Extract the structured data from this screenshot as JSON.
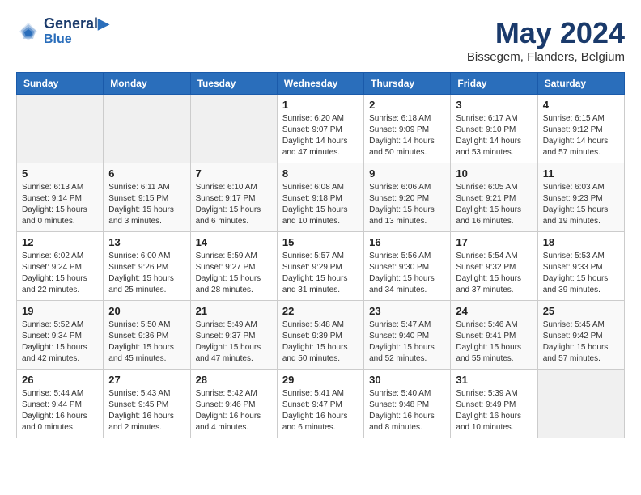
{
  "header": {
    "logo_line1": "General",
    "logo_line2": "Blue",
    "month_year": "May 2024",
    "location": "Bissegem, Flanders, Belgium"
  },
  "weekdays": [
    "Sunday",
    "Monday",
    "Tuesday",
    "Wednesday",
    "Thursday",
    "Friday",
    "Saturday"
  ],
  "weeks": [
    [
      {
        "day": "",
        "empty": true
      },
      {
        "day": "",
        "empty": true
      },
      {
        "day": "",
        "empty": true
      },
      {
        "day": "1",
        "sunrise": "6:20 AM",
        "sunset": "9:07 PM",
        "daylight": "14 hours and 47 minutes."
      },
      {
        "day": "2",
        "sunrise": "6:18 AM",
        "sunset": "9:09 PM",
        "daylight": "14 hours and 50 minutes."
      },
      {
        "day": "3",
        "sunrise": "6:17 AM",
        "sunset": "9:10 PM",
        "daylight": "14 hours and 53 minutes."
      },
      {
        "day": "4",
        "sunrise": "6:15 AM",
        "sunset": "9:12 PM",
        "daylight": "14 hours and 57 minutes."
      }
    ],
    [
      {
        "day": "5",
        "sunrise": "6:13 AM",
        "sunset": "9:14 PM",
        "daylight": "15 hours and 0 minutes."
      },
      {
        "day": "6",
        "sunrise": "6:11 AM",
        "sunset": "9:15 PM",
        "daylight": "15 hours and 3 minutes."
      },
      {
        "day": "7",
        "sunrise": "6:10 AM",
        "sunset": "9:17 PM",
        "daylight": "15 hours and 6 minutes."
      },
      {
        "day": "8",
        "sunrise": "6:08 AM",
        "sunset": "9:18 PM",
        "daylight": "15 hours and 10 minutes."
      },
      {
        "day": "9",
        "sunrise": "6:06 AM",
        "sunset": "9:20 PM",
        "daylight": "15 hours and 13 minutes."
      },
      {
        "day": "10",
        "sunrise": "6:05 AM",
        "sunset": "9:21 PM",
        "daylight": "15 hours and 16 minutes."
      },
      {
        "day": "11",
        "sunrise": "6:03 AM",
        "sunset": "9:23 PM",
        "daylight": "15 hours and 19 minutes."
      }
    ],
    [
      {
        "day": "12",
        "sunrise": "6:02 AM",
        "sunset": "9:24 PM",
        "daylight": "15 hours and 22 minutes."
      },
      {
        "day": "13",
        "sunrise": "6:00 AM",
        "sunset": "9:26 PM",
        "daylight": "15 hours and 25 minutes."
      },
      {
        "day": "14",
        "sunrise": "5:59 AM",
        "sunset": "9:27 PM",
        "daylight": "15 hours and 28 minutes."
      },
      {
        "day": "15",
        "sunrise": "5:57 AM",
        "sunset": "9:29 PM",
        "daylight": "15 hours and 31 minutes."
      },
      {
        "day": "16",
        "sunrise": "5:56 AM",
        "sunset": "9:30 PM",
        "daylight": "15 hours and 34 minutes."
      },
      {
        "day": "17",
        "sunrise": "5:54 AM",
        "sunset": "9:32 PM",
        "daylight": "15 hours and 37 minutes."
      },
      {
        "day": "18",
        "sunrise": "5:53 AM",
        "sunset": "9:33 PM",
        "daylight": "15 hours and 39 minutes."
      }
    ],
    [
      {
        "day": "19",
        "sunrise": "5:52 AM",
        "sunset": "9:34 PM",
        "daylight": "15 hours and 42 minutes."
      },
      {
        "day": "20",
        "sunrise": "5:50 AM",
        "sunset": "9:36 PM",
        "daylight": "15 hours and 45 minutes."
      },
      {
        "day": "21",
        "sunrise": "5:49 AM",
        "sunset": "9:37 PM",
        "daylight": "15 hours and 47 minutes."
      },
      {
        "day": "22",
        "sunrise": "5:48 AM",
        "sunset": "9:39 PM",
        "daylight": "15 hours and 50 minutes."
      },
      {
        "day": "23",
        "sunrise": "5:47 AM",
        "sunset": "9:40 PM",
        "daylight": "15 hours and 52 minutes."
      },
      {
        "day": "24",
        "sunrise": "5:46 AM",
        "sunset": "9:41 PM",
        "daylight": "15 hours and 55 minutes."
      },
      {
        "day": "25",
        "sunrise": "5:45 AM",
        "sunset": "9:42 PM",
        "daylight": "15 hours and 57 minutes."
      }
    ],
    [
      {
        "day": "26",
        "sunrise": "5:44 AM",
        "sunset": "9:44 PM",
        "daylight": "16 hours and 0 minutes."
      },
      {
        "day": "27",
        "sunrise": "5:43 AM",
        "sunset": "9:45 PM",
        "daylight": "16 hours and 2 minutes."
      },
      {
        "day": "28",
        "sunrise": "5:42 AM",
        "sunset": "9:46 PM",
        "daylight": "16 hours and 4 minutes."
      },
      {
        "day": "29",
        "sunrise": "5:41 AM",
        "sunset": "9:47 PM",
        "daylight": "16 hours and 6 minutes."
      },
      {
        "day": "30",
        "sunrise": "5:40 AM",
        "sunset": "9:48 PM",
        "daylight": "16 hours and 8 minutes."
      },
      {
        "day": "31",
        "sunrise": "5:39 AM",
        "sunset": "9:49 PM",
        "daylight": "16 hours and 10 minutes."
      },
      {
        "day": "",
        "empty": true
      }
    ]
  ]
}
